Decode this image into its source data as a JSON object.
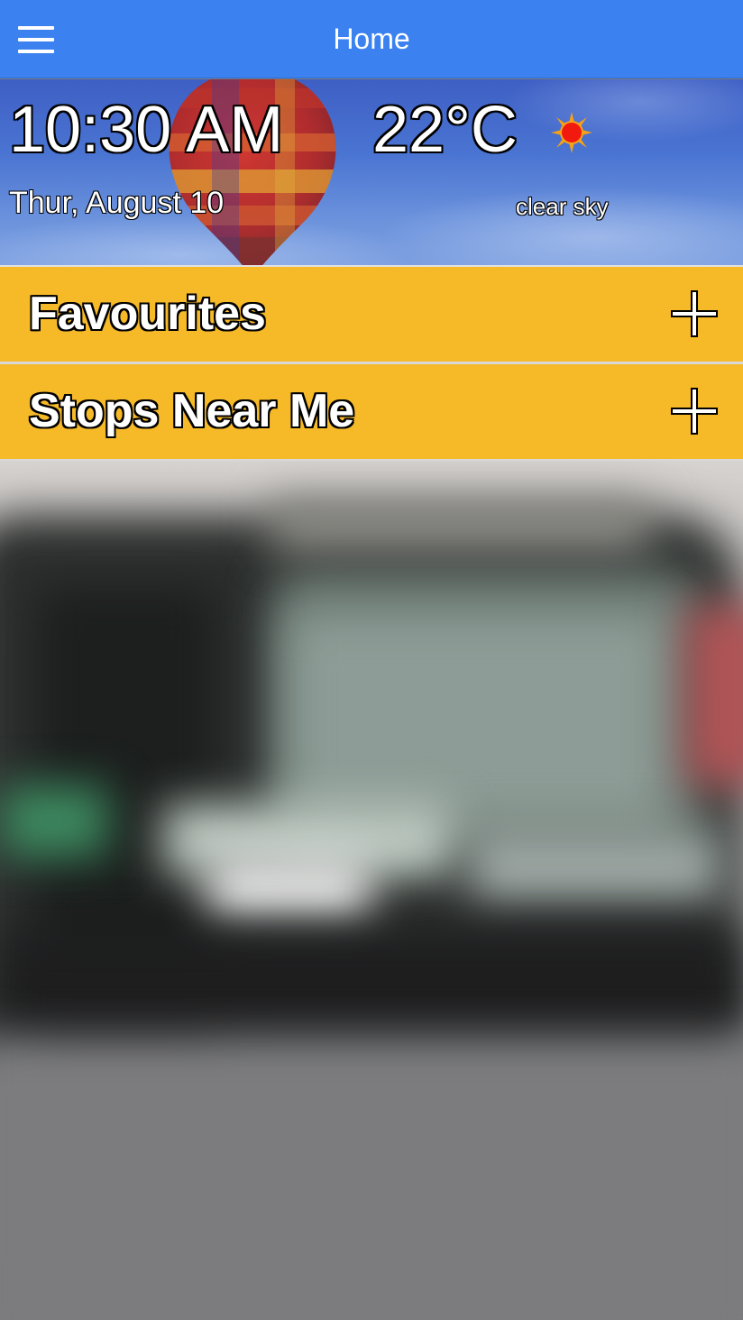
{
  "header": {
    "title": "Home",
    "menu_icon": "hamburger-menu-icon",
    "background_color": "#3b82f0"
  },
  "weather": {
    "time": "10:30 AM",
    "date": "Thur, August 10",
    "temperature": "22°C",
    "condition": "clear sky",
    "condition_icon": "sun-icon"
  },
  "sections": [
    {
      "label": "Favourites",
      "action_icon": "plus-icon"
    },
    {
      "label": "Stops Near Me",
      "action_icon": "plus-icon"
    }
  ],
  "colors": {
    "section_background": "#f6b928",
    "text": "#ffffff"
  },
  "background_image": "blurred-bus-photo"
}
